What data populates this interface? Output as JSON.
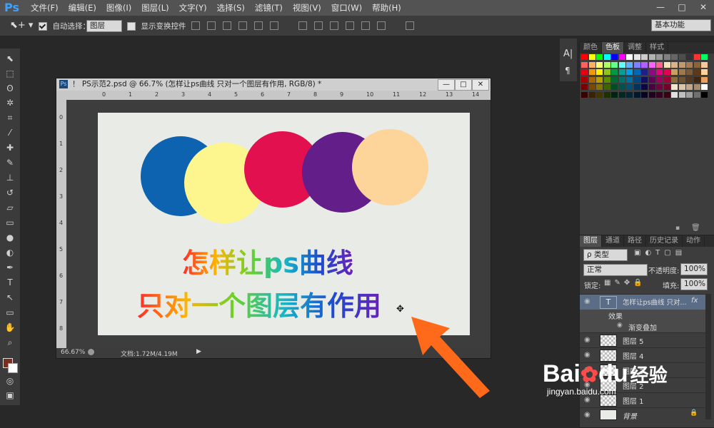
{
  "app": {
    "logo": "Ps",
    "menu": [
      "文件(F)",
      "编辑(E)",
      "图像(I)",
      "图层(L)",
      "文字(Y)",
      "选择(S)",
      "滤镜(T)",
      "视图(V)",
      "窗口(W)",
      "帮助(H)"
    ],
    "window_buttons": [
      "—",
      "□",
      "✕"
    ]
  },
  "options_bar": {
    "auto_select_label": "自动选择：",
    "auto_select_value": "图层",
    "show_transform_label": "显示变换控件",
    "workspace": "基本功能"
  },
  "document": {
    "title": "！ PS示范2.psd @ 66.7% (怎样让ps曲线 只对一个图层有作用, RGB/8) *",
    "zoom": "66.67%",
    "doc_size": "文档:1.72M/4.19M",
    "ruler_h": [
      "0",
      "1",
      "2",
      "3",
      "4",
      "5",
      "6",
      "7",
      "8",
      "9",
      "10",
      "11",
      "12",
      "13",
      "14"
    ],
    "ruler_v": [
      "0",
      "1",
      "2",
      "3",
      "4",
      "5",
      "6",
      "7",
      "8"
    ],
    "text_line1": "怎样让ps曲线",
    "text_line2": "只对一个图层有作用",
    "circle_colors": [
      "#0d63b0",
      "#fdf68f",
      "#e3104f",
      "#631e89",
      "#fdd49a"
    ]
  },
  "swatches_panel": {
    "tabs": [
      "颜色",
      "色板",
      "调整",
      "样式"
    ],
    "active_tab": "色板"
  },
  "layers_panel": {
    "tabs": [
      "图层",
      "通道",
      "路径",
      "历史记录",
      "动作"
    ],
    "active_tab": "图层",
    "filter_label": "ρ 类型",
    "blend_mode": "正常",
    "opacity_label": "不透明度:",
    "opacity_value": "100%",
    "lock_label": "锁定:",
    "fill_label": "填充:",
    "fill_value": "100%",
    "text_layer_name": "怎样让ps曲线 只对...",
    "effects_label": "效果",
    "gradient_overlay_label": "渐变叠加",
    "layers": [
      "图层 5",
      "图层 4",
      "图层 3",
      "图层 2",
      "图层 1",
      "背景"
    ]
  },
  "watermark": {
    "brand": "Bai",
    "brand2": "du",
    "cn": "经验",
    "url": "jingyan.baidu.com"
  }
}
